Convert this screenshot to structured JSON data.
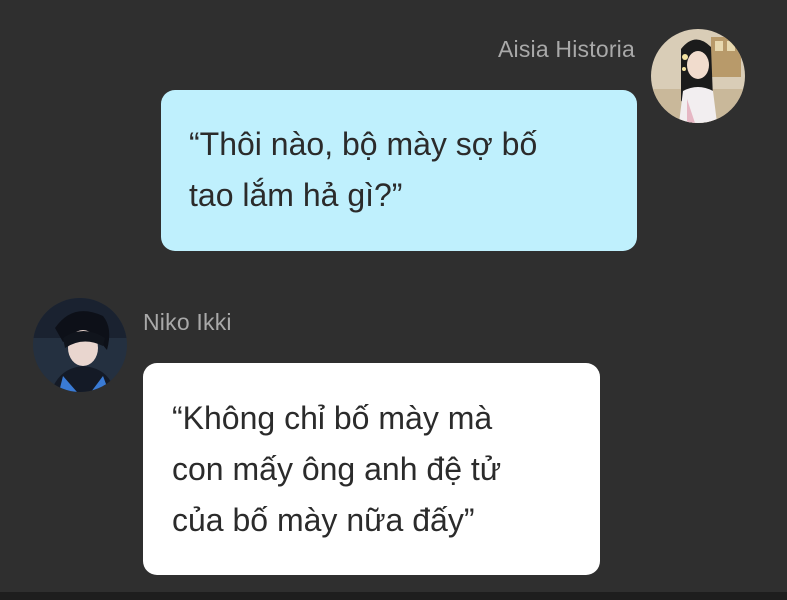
{
  "messages": {
    "outgoing": {
      "sender": "Aisia Historia",
      "lines": [
        "“Thôi nào, bộ mày sợ bố",
        "tao lắm hả gì?”"
      ]
    },
    "incoming": {
      "sender": "Niko Ikki",
      "lines": [
        "“Không chỉ bố mày mà",
        "con mấy ông anh đệ tử",
        "của bố mày nữa đấy”"
      ]
    }
  },
  "colors": {
    "background": "#2f2f2f",
    "outgoing_bubble": "#bff0fd",
    "incoming_bubble": "#ffffff",
    "sender_name": "#a9a9a9",
    "message_text": "#2b2b2b"
  }
}
